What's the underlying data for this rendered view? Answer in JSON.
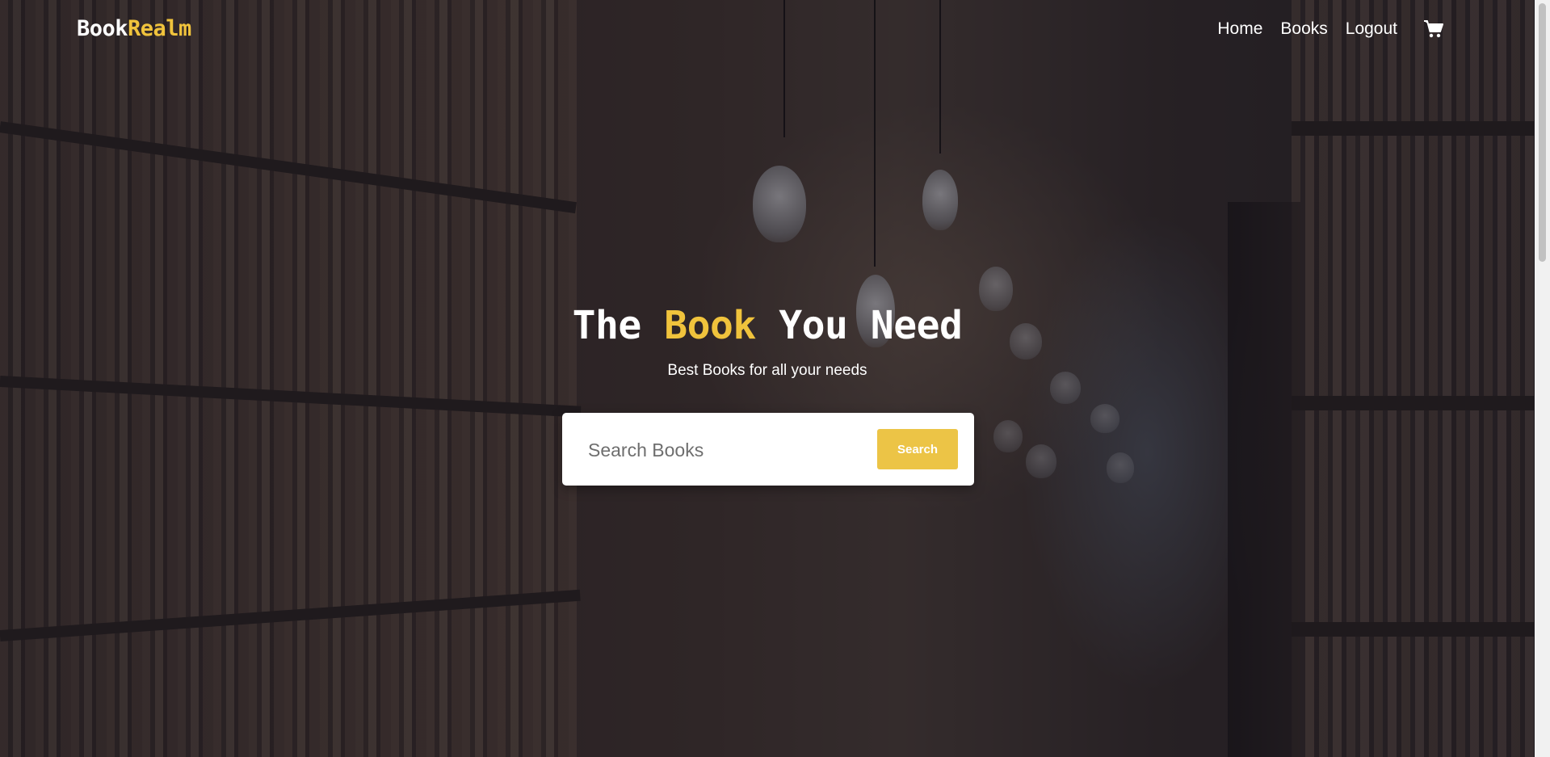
{
  "brand": {
    "name_part1": "Book",
    "name_part2": "Realm",
    "accent_color": "#f0c33c"
  },
  "nav": {
    "items": [
      {
        "label": "Home"
      },
      {
        "label": "Books"
      },
      {
        "label": "Logout"
      }
    ],
    "cart_icon": "cart-icon"
  },
  "hero": {
    "title_part1": "The",
    "title_highlight": "Book",
    "title_part2": "You Need",
    "subtitle": "Best Books for all your needs"
  },
  "search": {
    "placeholder": "Search Books",
    "value": "",
    "button_label": "Search",
    "button_color": "#ecc446"
  }
}
